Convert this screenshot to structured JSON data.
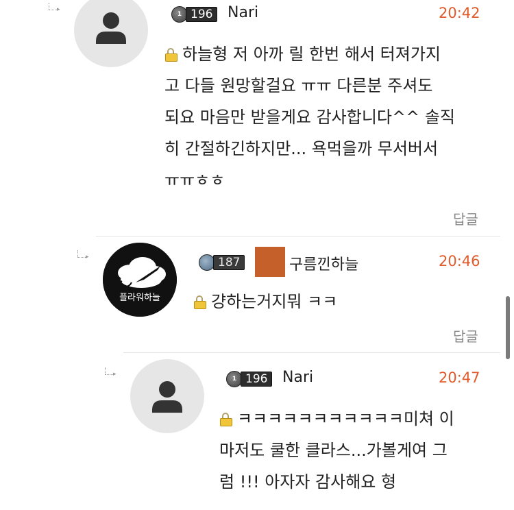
{
  "comments": [
    {
      "level": "196",
      "nickname": "Nari",
      "time": "20:42",
      "lines": [
        "하늘형 저 아까 릴 한번 해서 터져가지",
        "고 다들 원망할걸요 ㅠㅠ 다른분 주셔도",
        "되요 마음만 받을게요 감사합니다^^ 솔직",
        "히 간절하긴하지만... 욕먹을까 무서버서",
        "ㅠㅠㅎㅎ"
      ],
      "reply_label": "답글"
    },
    {
      "level": "187",
      "nickname": "구름낀하늘",
      "time": "20:46",
      "avatar_text": "플라워하늘",
      "lines": [
        "걍하는거지뭐 ㅋㅋ"
      ],
      "reply_label": "답글",
      "accent_color": "#c6602a"
    },
    {
      "level": "196",
      "nickname": "Nari",
      "time": "20:47",
      "lines": [
        "ㅋㅋㅋㅋㅋㅋㅋㅋㅋㅋㅋ미쳐 이",
        "마저도 쿨한 클라스...가볼게여 그",
        "럼 !!! 아자자 감사해요 형"
      ]
    }
  ],
  "icons": {
    "reply_indicator": "reply-arrow-icon",
    "secret": "lock-icon",
    "default_avatar": "person-icon"
  },
  "colors": {
    "time": "#e05a2a",
    "reply_link": "#888888"
  }
}
